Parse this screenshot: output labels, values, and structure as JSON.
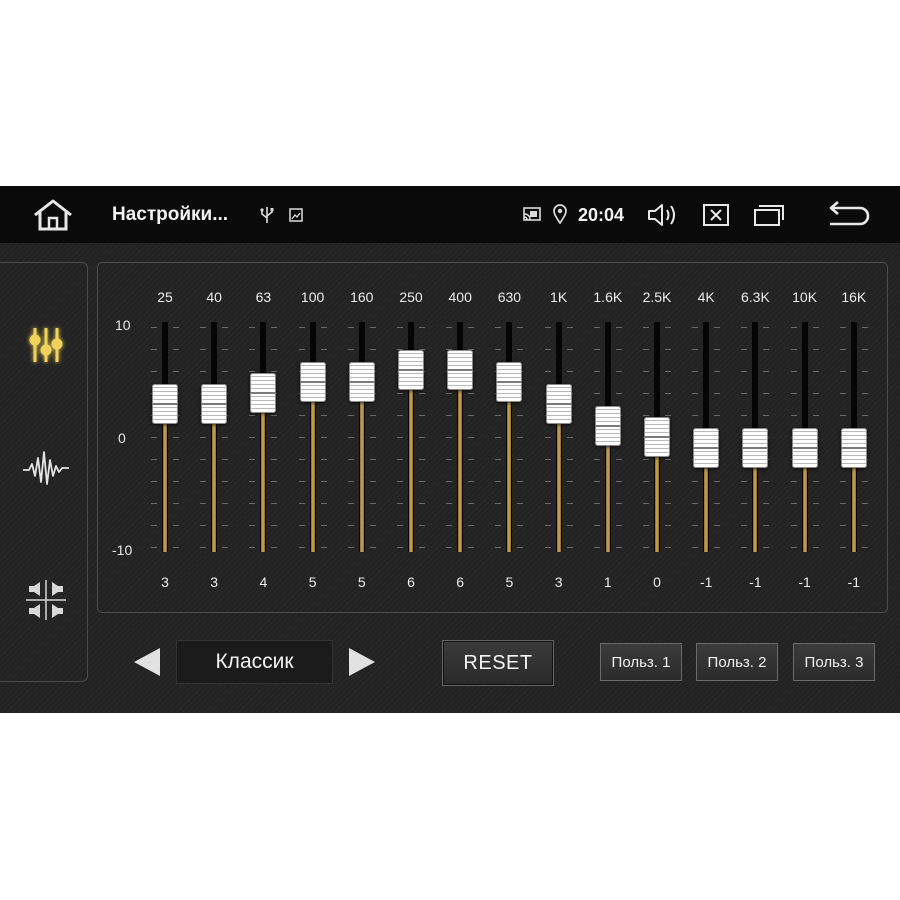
{
  "statusbar": {
    "title": "Настройки...",
    "time": "20:04",
    "icons": [
      "home-icon",
      "usb-icon",
      "image-icon",
      "cast-icon",
      "location-icon",
      "volume-icon",
      "close-icon",
      "recent-apps-icon",
      "back-icon"
    ]
  },
  "sidebar": {
    "items": [
      {
        "icon": "equalizer-icon",
        "active": true
      },
      {
        "icon": "waveform-icon",
        "active": false
      },
      {
        "icon": "balance-fader-icon",
        "active": false
      }
    ]
  },
  "equalizer": {
    "scale": {
      "top": "10",
      "mid": "0",
      "bottom": "-10"
    },
    "range": [
      -10,
      10
    ],
    "bands": [
      {
        "freq": "25",
        "value": "3"
      },
      {
        "freq": "40",
        "value": "3"
      },
      {
        "freq": "63",
        "value": "4"
      },
      {
        "freq": "100",
        "value": "5"
      },
      {
        "freq": "160",
        "value": "5"
      },
      {
        "freq": "250",
        "value": "6"
      },
      {
        "freq": "400",
        "value": "6"
      },
      {
        "freq": "630",
        "value": "5"
      },
      {
        "freq": "1K",
        "value": "3"
      },
      {
        "freq": "1.6K",
        "value": "1"
      },
      {
        "freq": "2.5K",
        "value": "0"
      },
      {
        "freq": "4K",
        "value": "-1"
      },
      {
        "freq": "6.3K",
        "value": "-1"
      },
      {
        "freq": "10K",
        "value": "-1"
      },
      {
        "freq": "16K",
        "value": "-1"
      }
    ]
  },
  "controls": {
    "preset": "Классик",
    "reset_label": "RESET",
    "user_presets": [
      "Польз. 1",
      "Польз. 2",
      "Польз. 3"
    ]
  },
  "colors": {
    "accent": "#e8c84a",
    "slider_fill": "#c9a253",
    "background": "#232323",
    "statusbar": "#0a0a0a"
  }
}
